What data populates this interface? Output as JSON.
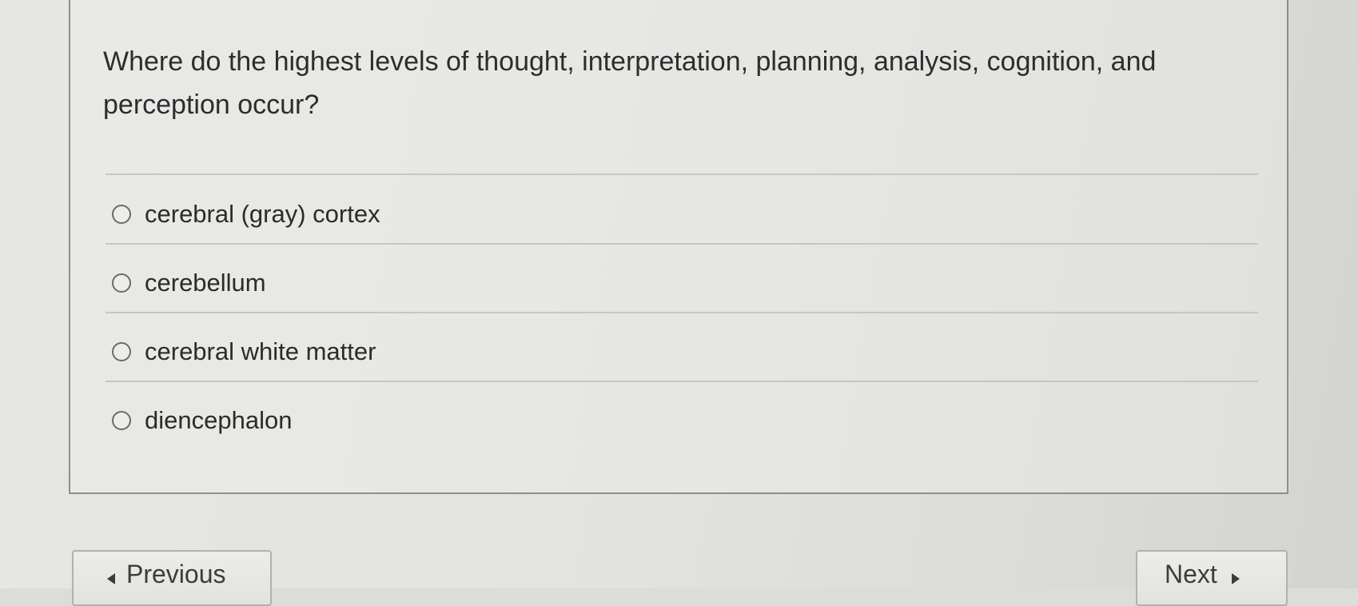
{
  "question": {
    "text": "Where do the highest levels of thought, interpretation, planning, analysis, cognition, and perception occur?"
  },
  "options": [
    {
      "label": "cerebral (gray) cortex",
      "selected": false
    },
    {
      "label": "cerebellum",
      "selected": false
    },
    {
      "label": "cerebral white matter",
      "selected": false
    },
    {
      "label": "diencephalon",
      "selected": false
    }
  ],
  "navigation": {
    "previous_label": "Previous",
    "next_label": "Next"
  },
  "icons": {
    "previous": "caret-left-icon",
    "next": "caret-right-icon",
    "radio": "radio-unselected-icon"
  }
}
